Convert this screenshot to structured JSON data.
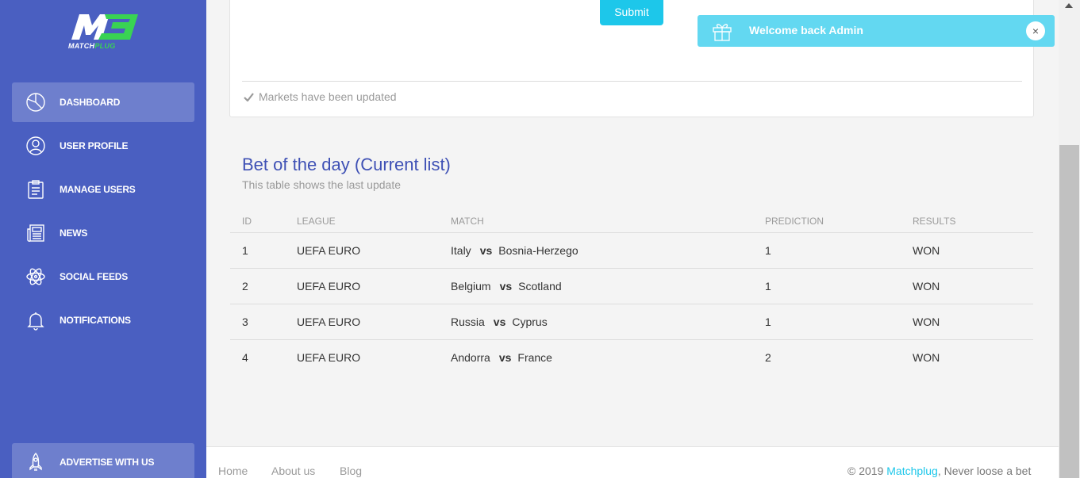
{
  "brand": {
    "logo_text_a": "MATCH",
    "logo_text_b": "PLUG"
  },
  "sidebar": {
    "items": [
      {
        "label": "DASHBOARD",
        "icon": "pie-chart-icon",
        "active": true
      },
      {
        "label": "USER PROFILE",
        "icon": "user-icon"
      },
      {
        "label": "MANAGE USERS",
        "icon": "clipboard-icon"
      },
      {
        "label": "NEWS",
        "icon": "newspaper-icon"
      },
      {
        "label": "SOCIAL FEEDS",
        "icon": "atom-icon"
      },
      {
        "label": "NOTIFICATIONS",
        "icon": "bell-icon"
      }
    ],
    "bottom_item": {
      "label": "ADVERTISE WITH US",
      "icon": "rocket-icon"
    }
  },
  "form_card": {
    "submit_label": "Submit",
    "footer_text": "Markets have been updated"
  },
  "toast": {
    "message_prefix": "Welcome back ",
    "message_user": "Admin",
    "close_label": "×"
  },
  "bet_section": {
    "title": "Bet of the day (Current list)",
    "subtitle": "This table shows the last update",
    "columns": [
      "ID",
      "LEAGUE",
      "MATCH",
      "PREDICTION",
      "RESULTS"
    ],
    "rows": [
      {
        "id": "1",
        "league": "UEFA EURO",
        "home": "Italy",
        "vs": "vs",
        "away": "Bosnia-Herzego",
        "prediction": "1",
        "result": "WON"
      },
      {
        "id": "2",
        "league": "UEFA EURO",
        "home": "Belgium",
        "vs": "vs",
        "away": "Scotland",
        "prediction": "1",
        "result": "WON"
      },
      {
        "id": "3",
        "league": "UEFA EURO",
        "home": "Russia",
        "vs": "vs",
        "away": "Cyprus",
        "prediction": "1",
        "result": "WON"
      },
      {
        "id": "4",
        "league": "UEFA EURO",
        "home": "Andorra",
        "vs": "vs",
        "away": "France",
        "prediction": "2",
        "result": "WON"
      }
    ]
  },
  "footer": {
    "links": [
      "Home",
      "About us",
      "Blog"
    ],
    "copyright_prefix": "© 2019 ",
    "copyright_brand": "Matchplug",
    "copyright_suffix": ", Never loose a bet"
  },
  "colors": {
    "sidebar": "#4a5fc1",
    "accent": "#1dc7ea",
    "title": "#3f51b5",
    "logo_green": "#39d353",
    "toast": "#63d8f1"
  }
}
